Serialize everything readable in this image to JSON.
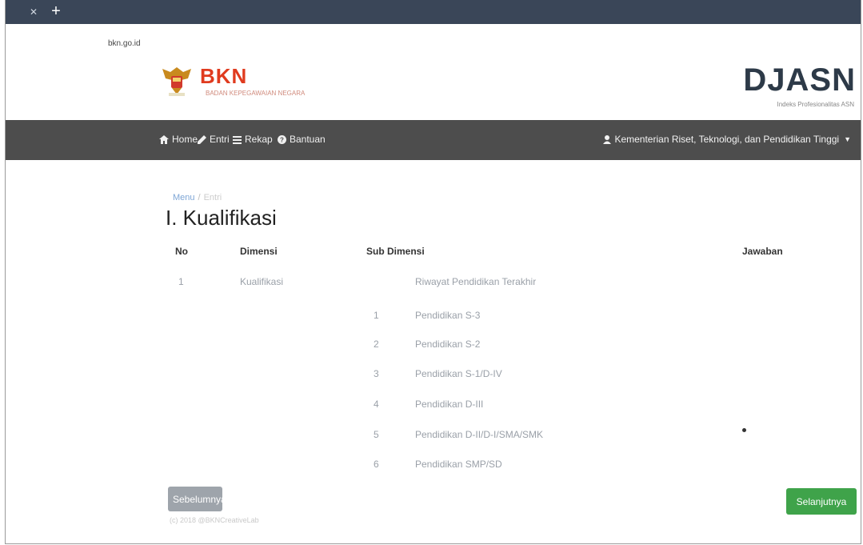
{
  "browser": {
    "url": "bkn.go.id"
  },
  "header": {
    "logo_text": "BKN",
    "logo_subtitle": "BADAN KEPEGAWAIAN NEGARA",
    "brand": "DJASN",
    "brand_subtitle": "Indeks Profesionalitas ASN"
  },
  "nav": {
    "items": [
      {
        "label": "Home",
        "icon": "home-icon"
      },
      {
        "label": "Entri",
        "icon": "pencil-icon"
      },
      {
        "label": "Rekap",
        "icon": "list-icon"
      },
      {
        "label": "Bantuan",
        "icon": "question-icon"
      }
    ],
    "user": "Kementerian Riset, Teknologi, dan Pendidikan Tinggi"
  },
  "breadcrumb": {
    "home": "Menu",
    "current": "Entri"
  },
  "page_title": "I. Kualifikasi",
  "table": {
    "headers": {
      "no": "No",
      "dimensi": "Dimensi",
      "sub_dimensi": "Sub Dimensi",
      "jawaban": "Jawaban"
    },
    "row": {
      "no": "1",
      "dimensi": "Kualifikasi",
      "sub_title": "Riwayat Pendidikan Terakhir"
    },
    "options": [
      {
        "no": "1",
        "label": "Pendidikan S-3"
      },
      {
        "no": "2",
        "label": "Pendidikan S-2"
      },
      {
        "no": "3",
        "label": "Pendidikan S-1/D-IV"
      },
      {
        "no": "4",
        "label": "Pendidikan D-III"
      },
      {
        "no": "5",
        "label": "Pendidikan D-II/D-I/SMA/SMK"
      },
      {
        "no": "6",
        "label": "Pendidikan SMP/SD"
      }
    ],
    "selected_option_index": 4
  },
  "buttons": {
    "prev": "Sebelumnya",
    "next": "Selanjutnya"
  },
  "footer": "(c) 2018 @BKNCreativeLab",
  "colors": {
    "logo_red": "#e03b1f",
    "navbar": "#4d4d4d",
    "next_button": "#3fa34a",
    "prev_button": "#9ea4ab",
    "link": "#7ea6d6"
  }
}
